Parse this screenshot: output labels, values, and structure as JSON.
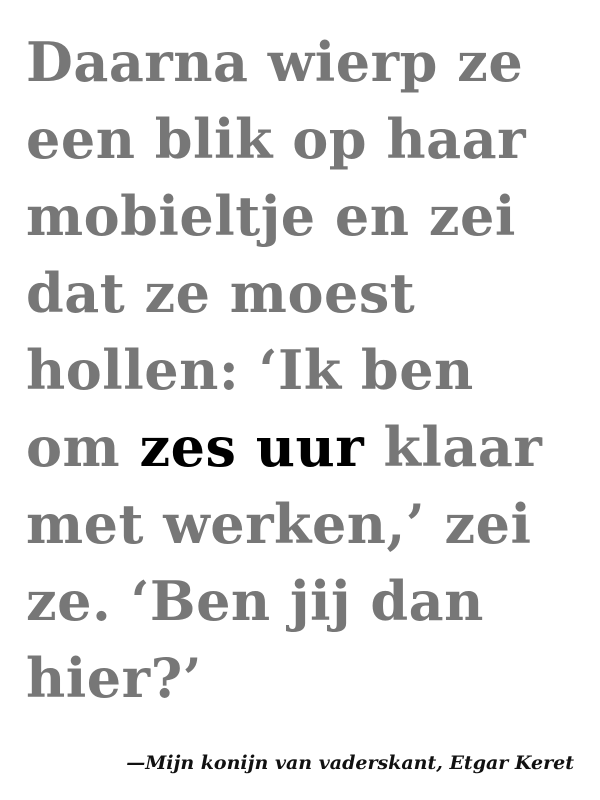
{
  "quote": {
    "lines": [
      "Daarna wierp ze",
      "een blik op haar",
      "mobieltje en zei",
      "dat ze moest",
      "hollen: ‘Ik ben"
    ],
    "line6_before": "om ",
    "line6_emphasis": "zes uur",
    "line6_after": " klaar",
    "lines_after": [
      "met werken,’ zei",
      "ze. ‘Ben jij dan",
      "hier?’"
    ]
  },
  "citation": "—Mijn konijn van vaderskant, Etgar Keret",
  "colors": {
    "text_gray": "#777777",
    "emphasis_black": "#000000"
  }
}
